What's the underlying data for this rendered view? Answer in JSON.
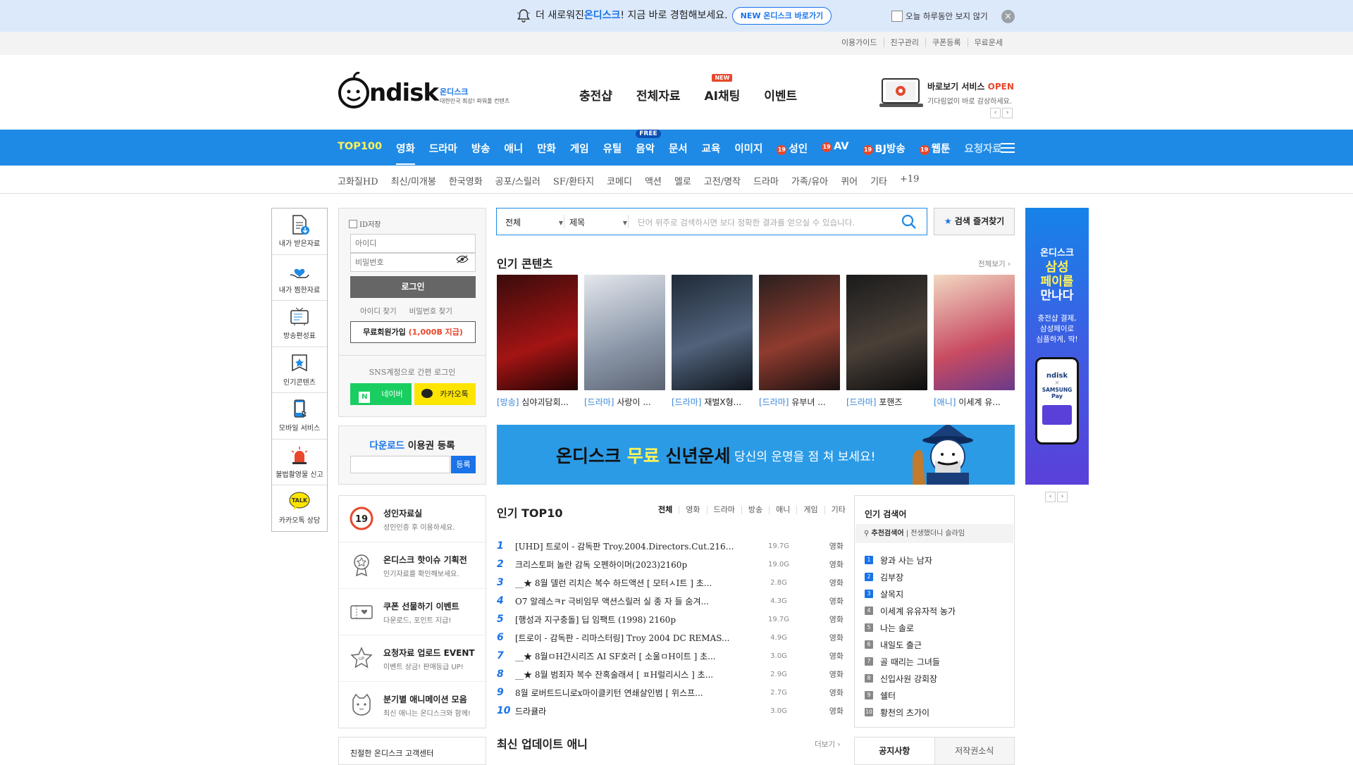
{
  "notice": {
    "prefix": "더 새로워진 ",
    "brand": "온디스크",
    "suffix": "! 지금 바로 경험해보세요.",
    "new_button": "NEW 온디스크 바로가기",
    "hide_today": "오늘 하루동안 보지 않기",
    "close": "×"
  },
  "util_links": [
    "이용가이드",
    "친구관리",
    "쿠폰등록",
    "무료운세"
  ],
  "header": {
    "logo_text": "ndisk",
    "logo_sub": "온디스크",
    "logo_tagline": "대한민국 최강! 파워풀 컨텐츠",
    "gnb": [
      "충전샵",
      "전체자료",
      "AI채팅",
      "이벤트"
    ],
    "gnb_new_badge": "NEW",
    "promo_title": "바로보기 서비스",
    "promo_open": "OPEN",
    "promo_sub": "기다림없이 바로 감상하세요."
  },
  "category_nav": {
    "items": [
      "TOP100",
      "영화",
      "드라마",
      "방송",
      "애니",
      "만화",
      "게임",
      "유틸",
      "음악",
      "문서",
      "교육",
      "이미지",
      "성인",
      "AV",
      "BJ방송",
      "웹툰",
      "요청자료"
    ],
    "free_badge": "FREE",
    "adult_badge": "19"
  },
  "sub_nav": [
    "고화질HD",
    "최신/미개봉",
    "한국영화",
    "공포/스릴러",
    "SF/환타지",
    "코메디",
    "액션",
    "멜로",
    "고전/명작",
    "드라마",
    "가족/유아",
    "퀴어",
    "기타",
    "+19"
  ],
  "quick_menu": [
    "내가 받은자료",
    "내가 찜한자료",
    "방송편성표",
    "인기콘텐츠",
    "모바일 서비스",
    "불법촬영물 신고",
    "카카오톡 상담"
  ],
  "login": {
    "id_save": "ID저장",
    "id_placeholder": "아이디",
    "pw_placeholder": "비밀번호",
    "login_button": "로그인",
    "find_id": "아이디 찾기",
    "find_pw": "비밀번호 찾기",
    "join_prefix": "무료회원가입 ",
    "join_bonus": "(1,000B 지급)",
    "sns_text": "SNS계정으로 간편 로그인",
    "naver": "네이버",
    "kakao": "카카오톡"
  },
  "download_reg": {
    "title_highlight": "다운로드",
    "title_rest": " 이용권 등록",
    "button": "등록"
  },
  "events": [
    {
      "title": "성인자료실",
      "desc": "성인인증 후 이용하세요."
    },
    {
      "title": "온디스크 핫이슈 기획전",
      "desc": "인기자료를 확인해보세요."
    },
    {
      "title": "쿠폰 선물하기 이벤트",
      "desc": "다운로드, 포인트 지급!"
    },
    {
      "title": "요청자료 업로드 EVENT",
      "desc": "이벤트 상금! 판매등급 UP!"
    },
    {
      "title": "분기별 애니메이션 모음",
      "desc": "최신 애니는 온디스크와 함께!"
    }
  ],
  "customer_center": "친절한 온디스크 고객센터",
  "search": {
    "scope": "전체",
    "field": "제목",
    "placeholder": "단어 위주로 검색하시면 보다 정확한 결과를 얻으실 수 있습니다.",
    "favorites": "검색 즐겨찾기"
  },
  "popular": {
    "title": "인기 콘텐츠",
    "more": "전체보기 ›",
    "items": [
      {
        "genre": "[방송]",
        "title": "심야괴담회...",
        "colors": [
          "#3a0b0b",
          "#a31414"
        ]
      },
      {
        "genre": "[드라마]",
        "title": "사랑이 ...",
        "colors": [
          "#d9dde3",
          "#8a96a8"
        ]
      },
      {
        "genre": "[드라마]",
        "title": "재벌X형...",
        "colors": [
          "#1f2a38",
          "#51627a"
        ]
      },
      {
        "genre": "[드라마]",
        "title": "유부녀 ...",
        "colors": [
          "#2a1f1f",
          "#8f3b2e"
        ]
      },
      {
        "genre": "[드라마]",
        "title": "포핸즈",
        "colors": [
          "#1b1b1b",
          "#4a4038"
        ]
      },
      {
        "genre": "[애니]",
        "title": "이세계 유...",
        "colors": [
          "#f2d8c2",
          "#c84b62"
        ]
      }
    ]
  },
  "banner": {
    "part1": "온디스크 ",
    "highlight": "무료",
    "part2": " 신년운세",
    "sub": "당신의 운명을 점 쳐 보세요!"
  },
  "top10": {
    "title": "인기 TOP10",
    "tabs": [
      "전체",
      "영화",
      "드라마",
      "방송",
      "애니",
      "게임",
      "기타"
    ],
    "rows": [
      {
        "rank": "1",
        "title": "[UHD] 트로이 - 감독판 Troy.2004.Directors.Cut.2160P....",
        "size": "19.7G",
        "cat": "영화"
      },
      {
        "rank": "2",
        "title": "크리스토퍼 놀란 감독 오펜하이머(2023)2160p",
        "size": "19.0G",
        "cat": "영화"
      },
      {
        "rank": "3",
        "title": "__★ 8월 델런 리치슨 복수 하드액션 [ 모터ㅅI트 ] 초...",
        "size": "2.8G",
        "cat": "영화"
      },
      {
        "rank": "4",
        "title": "O7 알레스ㅋr 극비임무 액션스릴러 실 종 자 들 숨겨...",
        "size": "4.3G",
        "cat": "영화"
      },
      {
        "rank": "5",
        "title": "[행성과 지구충돌] 딥 임팩트 (1998) 2160p",
        "size": "19.7G",
        "cat": "영화"
      },
      {
        "rank": "6",
        "title": "[트로이 - 감독판 - 리마스터링] Troy 2004 DC REMAS...",
        "size": "4.9G",
        "cat": "영화"
      },
      {
        "rank": "7",
        "title": "__★ 8월ㅁH간시리즈 AI SF호러 [ 소울ㅁH이트 ] 초...",
        "size": "3.0G",
        "cat": "영화"
      },
      {
        "rank": "8",
        "title": "__★ 8월 범죄자 복수 잔혹술래셔 [ ㅍH럴리시스 ] 초...",
        "size": "2.9G",
        "cat": "영화"
      },
      {
        "rank": "9",
        "title": "8월 로버트드니로x마이클키턴 연쇄살인범 [ 위스프...",
        "size": "2.7G",
        "cat": "영화"
      },
      {
        "rank": "10",
        "title": "드라큘라",
        "size": "3.0G",
        "cat": "영화"
      }
    ]
  },
  "latest_anime": {
    "title": "최신 업데이트 애니",
    "more": "더보기 ›"
  },
  "popular_search": {
    "title": "인기 검색어",
    "recommend_label": "추천검색어",
    "recommend_items": "전생했더니 슬라임",
    "items": [
      "왕과 사는 남자",
      "김부장",
      "살목지",
      "이세계 유유자적 농가",
      "나는 솔로",
      "내일도 출근",
      "골 때리는 그녀들",
      "신입사원 강회장",
      "쉘터",
      "황천의 츠가이"
    ]
  },
  "notice_tabs": [
    "공지사항",
    "저작권소식"
  ],
  "right_ad": {
    "line1": "온디스크",
    "line2": "삼성",
    "line3": "페이를",
    "line4": "만나다",
    "desc1": "충전샵 결제,",
    "desc2": "삼성페이로",
    "desc3": "심플하게, 딱!",
    "phone_logo": "ndisk",
    "phone_x": "×",
    "phone_pay": "SAMSUNG",
    "phone_pay2": "Pay"
  },
  "colors": {
    "primary_blue": "#1f8ae5",
    "accent_red": "#e8472b",
    "highlight_yellow": "#fff35a",
    "naver_green": "#19ce60",
    "kakao_yellow": "#fee500"
  }
}
